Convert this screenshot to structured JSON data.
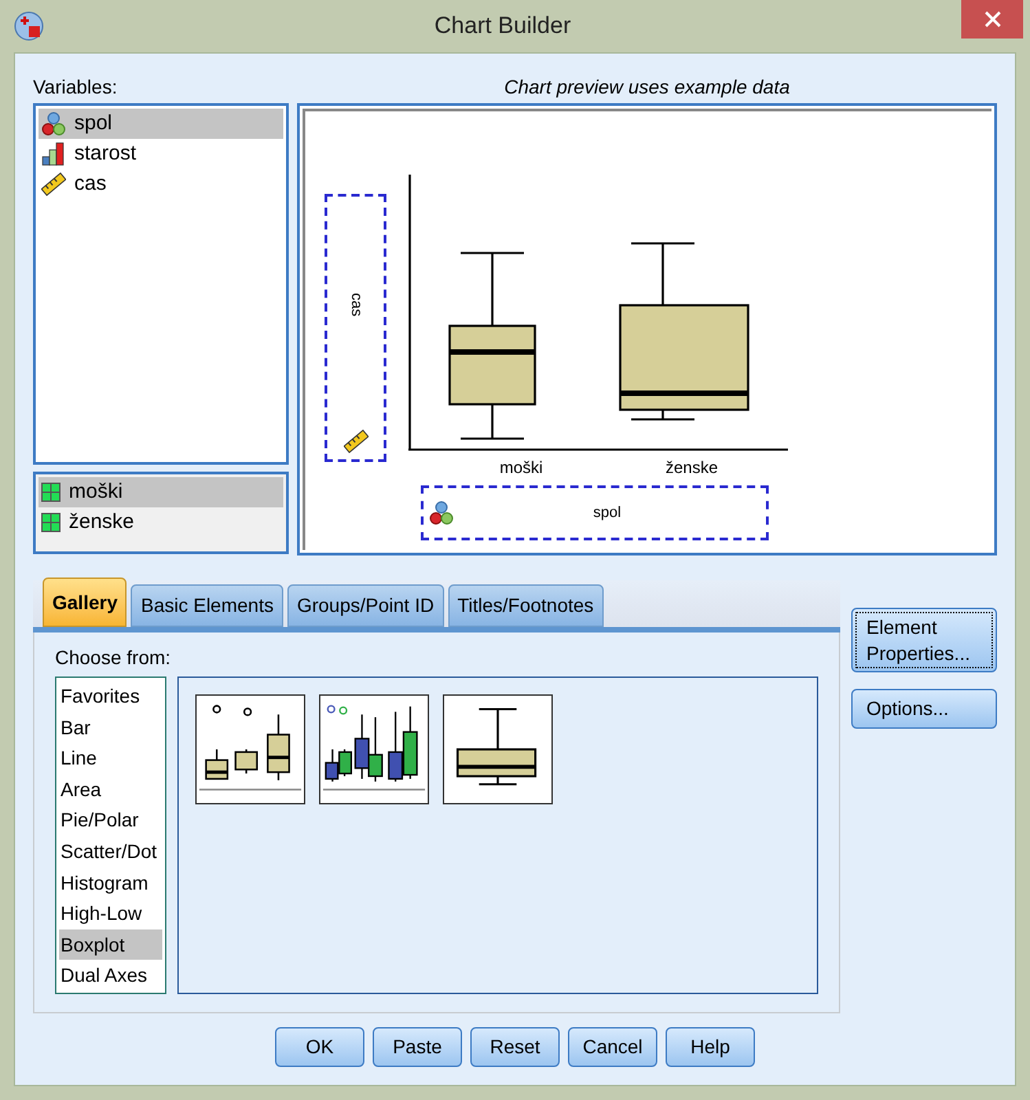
{
  "window": {
    "title": "Chart Builder"
  },
  "variables": {
    "label": "Variables:",
    "items": [
      {
        "name": "spol",
        "kind": "nominal",
        "selected": true
      },
      {
        "name": "starost",
        "kind": "ordinal",
        "selected": false
      },
      {
        "name": "cas",
        "kind": "scale",
        "selected": false
      }
    ]
  },
  "categories": [
    {
      "name": "moški",
      "selected": true
    },
    {
      "name": "ženske",
      "selected": false
    }
  ],
  "preview": {
    "caption": "Chart preview uses example data",
    "y_drop": {
      "label": "cas",
      "kind": "scale"
    },
    "x_drop": {
      "label": "spol",
      "kind": "nominal"
    },
    "x_labels": [
      "moški",
      "ženske"
    ]
  },
  "tabs": [
    {
      "label": "Gallery",
      "selected": true
    },
    {
      "label": "Basic Elements",
      "selected": false
    },
    {
      "label": "Groups/Point ID",
      "selected": false
    },
    {
      "label": "Titles/Footnotes",
      "selected": false
    }
  ],
  "gallery": {
    "label": "Choose from:",
    "types": [
      {
        "label": "Favorites",
        "selected": false
      },
      {
        "label": "Bar",
        "selected": false
      },
      {
        "label": "Line",
        "selected": false
      },
      {
        "label": "Area",
        "selected": false
      },
      {
        "label": "Pie/Polar",
        "selected": false
      },
      {
        "label": "Scatter/Dot",
        "selected": false
      },
      {
        "label": "Histogram",
        "selected": false
      },
      {
        "label": "High-Low",
        "selected": false
      },
      {
        "label": "Boxplot",
        "selected": true
      },
      {
        "label": "Dual Axes",
        "selected": false
      }
    ],
    "thumbnails": [
      {
        "kind": "simple"
      },
      {
        "kind": "clustered"
      },
      {
        "kind": "one_d"
      }
    ]
  },
  "side_buttons": [
    "Element Properties...",
    "Options..."
  ],
  "buttons": [
    "OK",
    "Paste",
    "Reset",
    "Cancel",
    "Help"
  ]
}
